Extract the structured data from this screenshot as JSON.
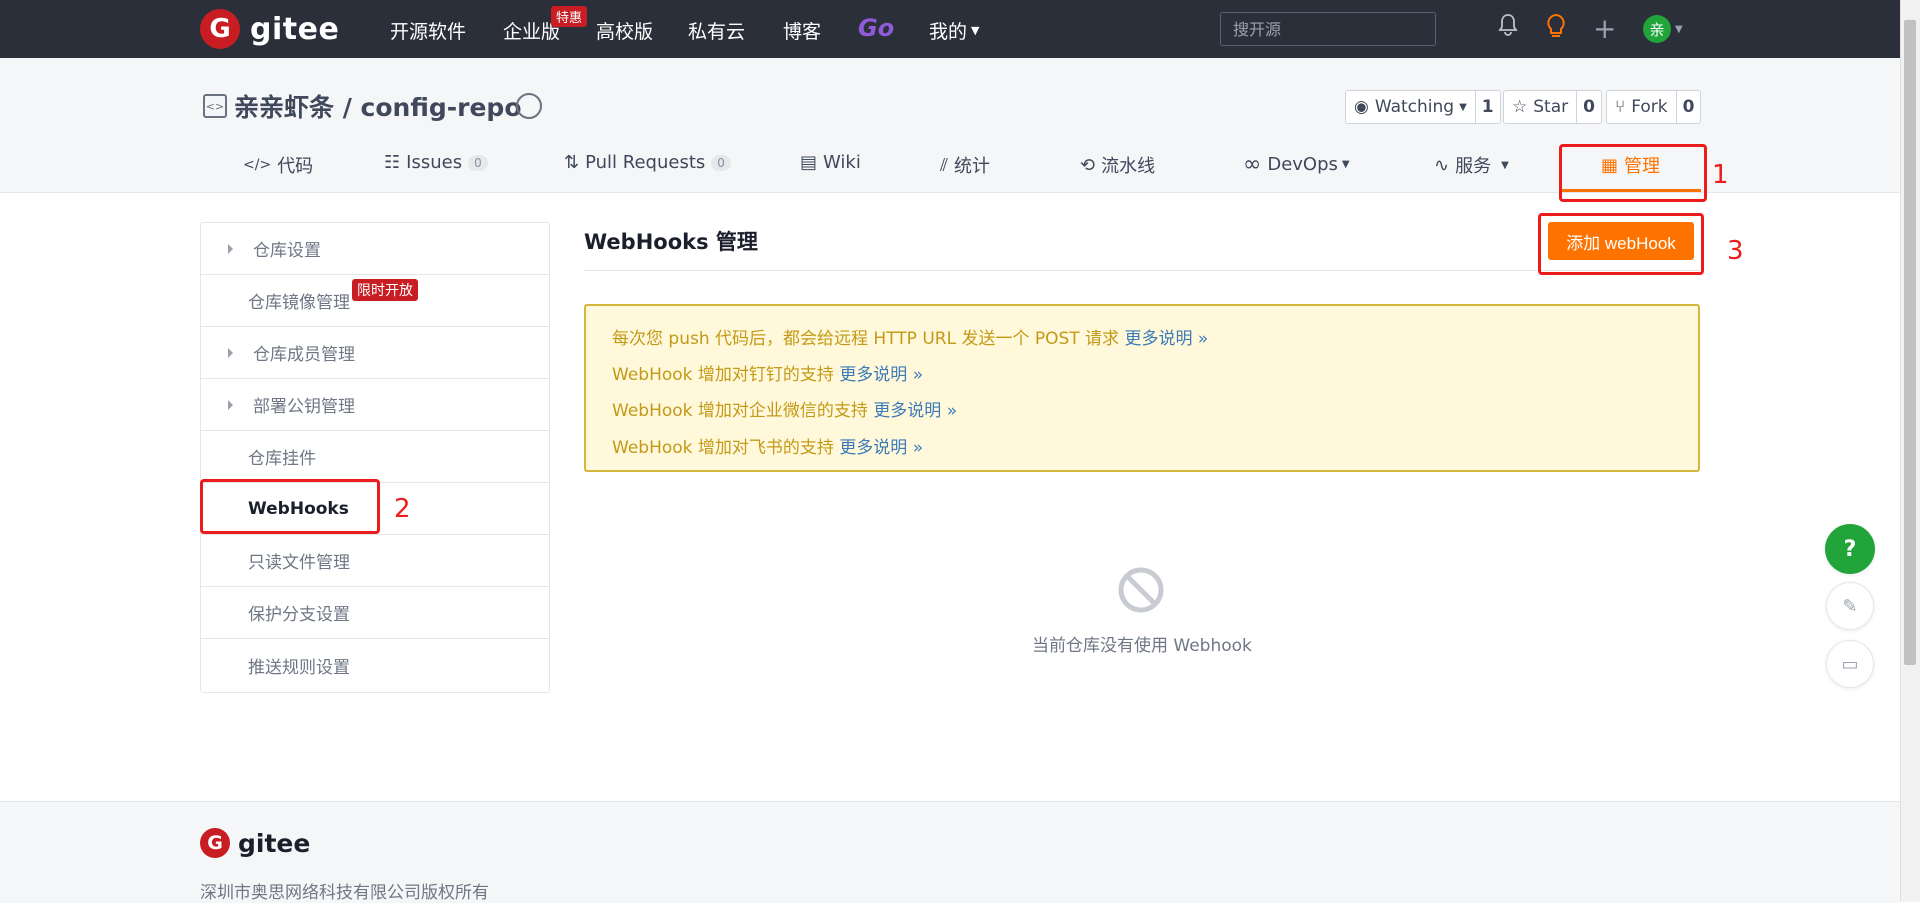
{
  "topnav": {
    "logo_letter": "G",
    "logo_text": "gitee",
    "items": [
      "开源软件",
      "企业版",
      "高校版",
      "私有云",
      "博客",
      "Go",
      "我的"
    ],
    "hot_badge": "特惠",
    "search_placeholder": "搜开源",
    "avatar_letter": "亲"
  },
  "repo": {
    "icon": "<>",
    "title": "亲亲虾条 / config-repo",
    "watch": {
      "label": "Watching",
      "count": "1"
    },
    "star": {
      "label": "Star",
      "count": "0"
    },
    "fork": {
      "label": "Fork",
      "count": "0"
    }
  },
  "tabs": [
    {
      "label": "代码",
      "icon": "</>"
    },
    {
      "label": "Issues",
      "count": "0"
    },
    {
      "label": "Pull Requests",
      "count": "0"
    },
    {
      "label": "Wiki"
    },
    {
      "label": "统计"
    },
    {
      "label": "流水线"
    },
    {
      "label": "DevOps"
    },
    {
      "label": "服务"
    },
    {
      "label": "管理"
    }
  ],
  "sidebar": {
    "items": [
      "仓库设置",
      "仓库镜像管理",
      "仓库成员管理",
      "部署公钥管理",
      "仓库挂件",
      "WebHooks",
      "只读文件管理",
      "保护分支设置",
      "推送规则设置"
    ],
    "limited_badge": "限时开放"
  },
  "main": {
    "title": "WebHooks 管理",
    "add_button": "添加 webHook",
    "notices": [
      {
        "text": "每次您 push 代码后，都会给远程 HTTP URL 发送一个 POST 请求",
        "more": "更多说明 »"
      },
      {
        "text": "WebHook 增加对钉钉的支持",
        "more": "更多说明 »"
      },
      {
        "text": "WebHook 增加对企业微信的支持",
        "more": "更多说明 »"
      },
      {
        "text": "WebHook 增加对飞书的支持",
        "more": "更多说明 »"
      }
    ],
    "empty_text": "当前仓库没有使用 Webhook"
  },
  "annotations": [
    "1",
    "2",
    "3"
  ],
  "floating": {
    "help": "?"
  },
  "footer": {
    "logo_letter": "G",
    "logo_text": "gitee",
    "copyright": "深圳市奥思网络科技有限公司版权所有"
  },
  "colors": {
    "accent": "#fe7300",
    "topbar": "#2b2f3a",
    "annotation": "#ec1c1c",
    "notice_bg": "#fff8db",
    "help_green": "#21a53b"
  }
}
